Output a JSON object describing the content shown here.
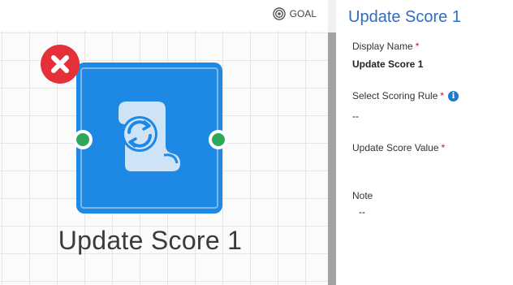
{
  "canvas": {
    "goal_label": "GOAL",
    "node": {
      "label": "Update Score 1",
      "icon": "score-refresh-icon",
      "color": "#1e88e5"
    }
  },
  "panel": {
    "title": "Update Score 1",
    "fields": {
      "display_name": {
        "label": "Display Name",
        "required_mark": "*",
        "value": "Update Score 1"
      },
      "scoring_rule": {
        "label": "Select Scoring Rule",
        "required_mark": "*",
        "info": "i",
        "value": "--"
      },
      "update_value": {
        "label": "Update Score Value",
        "required_mark": "*",
        "value": ""
      },
      "note": {
        "label": "Note",
        "value": "--"
      }
    }
  },
  "colors": {
    "accent": "#2f6cc0",
    "port": "#2fa85b",
    "delete": "#e5303a",
    "required": "#c8102e"
  }
}
